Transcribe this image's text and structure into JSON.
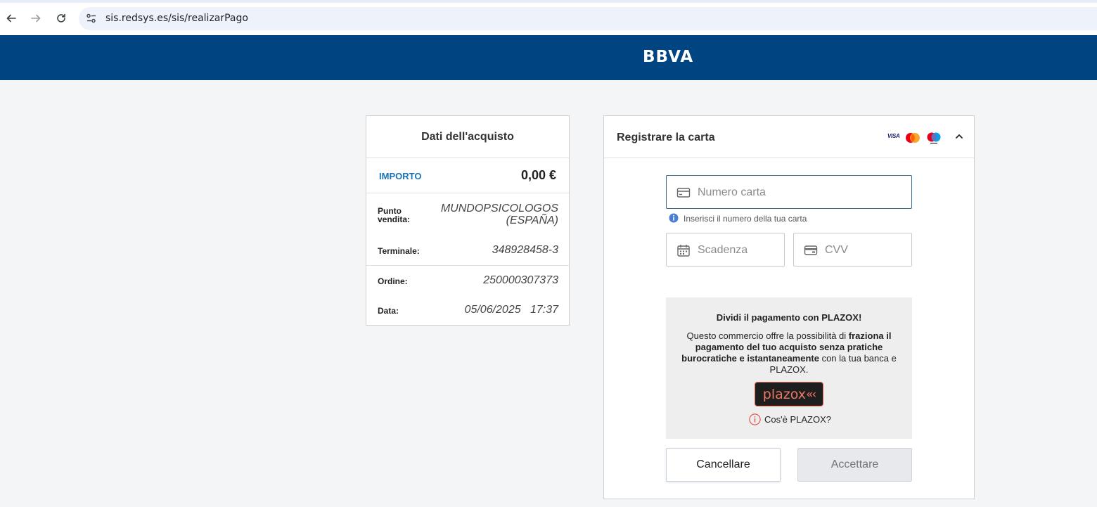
{
  "browser": {
    "url": "sis.redsys.es/sis/realizarPago"
  },
  "bank": {
    "logo_text": "BBVA",
    "brand_color": "#004481"
  },
  "purchase": {
    "title": "Dati dell'acquisto",
    "amount_label": "IMPORTO",
    "amount_value": "0,00 €",
    "rows": [
      {
        "label": "Punto vendita:",
        "value": "MUNDOPSICOLOGOS (ESPAÑA)"
      },
      {
        "label": "Terminale:",
        "value": "348928458-3"
      },
      {
        "label": "Ordine:",
        "value": "250000307373"
      },
      {
        "label": "Data:",
        "value": "05/06/2025   17:37"
      }
    ]
  },
  "card": {
    "title": "Registrare la carta",
    "brands": [
      "VISA",
      "mastercard-icon",
      "maestro-icon"
    ],
    "number_placeholder": "Numero carta",
    "number_hint": "Inserisci il numero della tua carta",
    "expiry_placeholder": "Scadenza",
    "cvv_placeholder": "CVV"
  },
  "plazox": {
    "title": "Dividi il pagamento con PLAZOX!",
    "desc_1": "Questo commercio offre la possibilità di ",
    "desc_bold": "fraziona il pagamento del tuo acquisto senza pratiche burocratiche e istantaneamente",
    "desc_2": " con la tua banca e PLAZOX.",
    "logo_text": "plazox",
    "logo_chevrons": "«‹",
    "link": "Cos'è PLAZOX?"
  },
  "actions": {
    "cancel_label": "Cancellare",
    "accept_label": "Accettare"
  }
}
